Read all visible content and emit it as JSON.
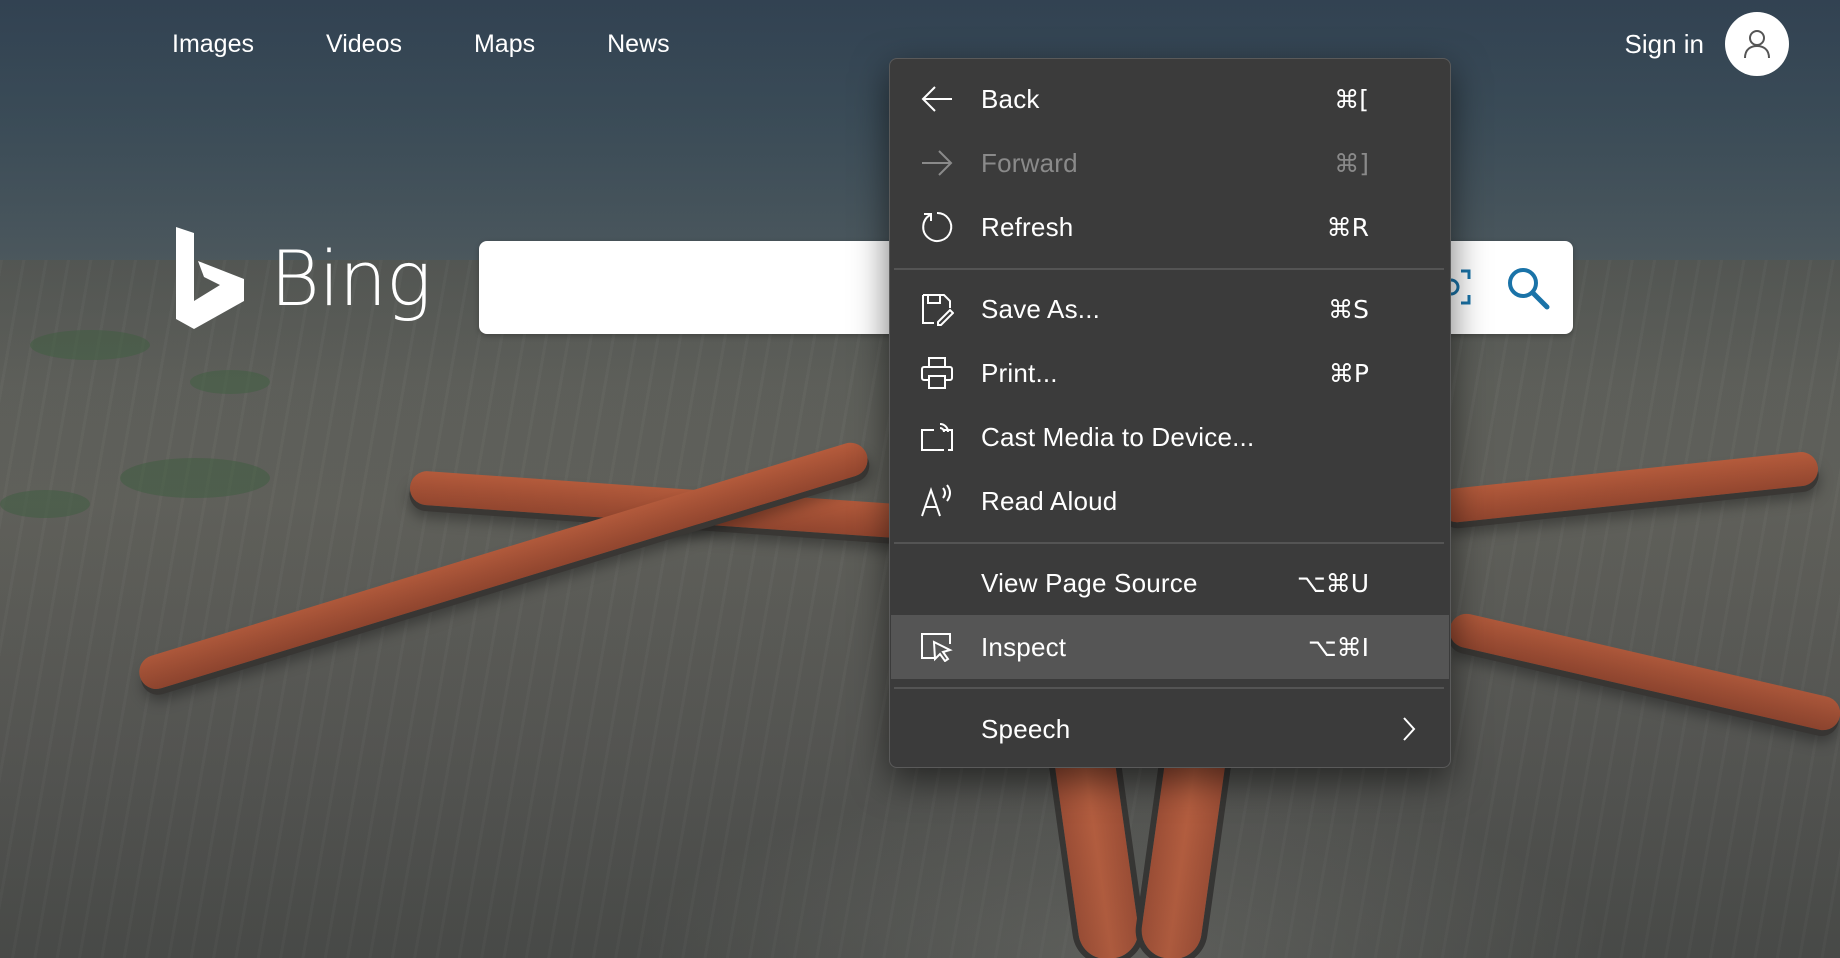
{
  "nav": {
    "links": [
      "Images",
      "Videos",
      "Maps",
      "News"
    ],
    "signin": "Sign in",
    "avatar_icon": "person-icon"
  },
  "brand": {
    "name": "Bing",
    "color": "#ffffff"
  },
  "search": {
    "value": "",
    "placeholder": "",
    "visual_search_icon": "visual-search-icon",
    "submit_icon": "search-icon",
    "accent": "#1a73a8"
  },
  "context_menu": {
    "back": {
      "label": "Back",
      "shortcut": "⌘[",
      "icon": "arrow-left-icon"
    },
    "forward": {
      "label": "Forward",
      "shortcut": "⌘]",
      "icon": "arrow-right-icon",
      "disabled": true
    },
    "refresh": {
      "label": "Refresh",
      "shortcut": "⌘R",
      "icon": "refresh-icon"
    },
    "save_as": {
      "label": "Save As...",
      "shortcut": "⌘S",
      "icon": "save-icon"
    },
    "print": {
      "label": "Print...",
      "shortcut": "⌘P",
      "icon": "printer-icon"
    },
    "cast": {
      "label": "Cast Media to Device...",
      "icon": "cast-icon"
    },
    "read_aloud": {
      "label": "Read Aloud",
      "icon": "read-aloud-icon"
    },
    "view_source": {
      "label": "View Page Source",
      "shortcut": "⌥⌘U"
    },
    "inspect": {
      "label": "Inspect",
      "shortcut": "⌥⌘I",
      "icon": "inspect-icon",
      "highlighted": true
    },
    "speech": {
      "label": "Speech",
      "icon": "chevron-right-icon"
    }
  },
  "colors": {
    "menu_bg": "#3b3b3b",
    "menu_highlight": "#555555",
    "disabled_text": "#8a8a8a"
  }
}
